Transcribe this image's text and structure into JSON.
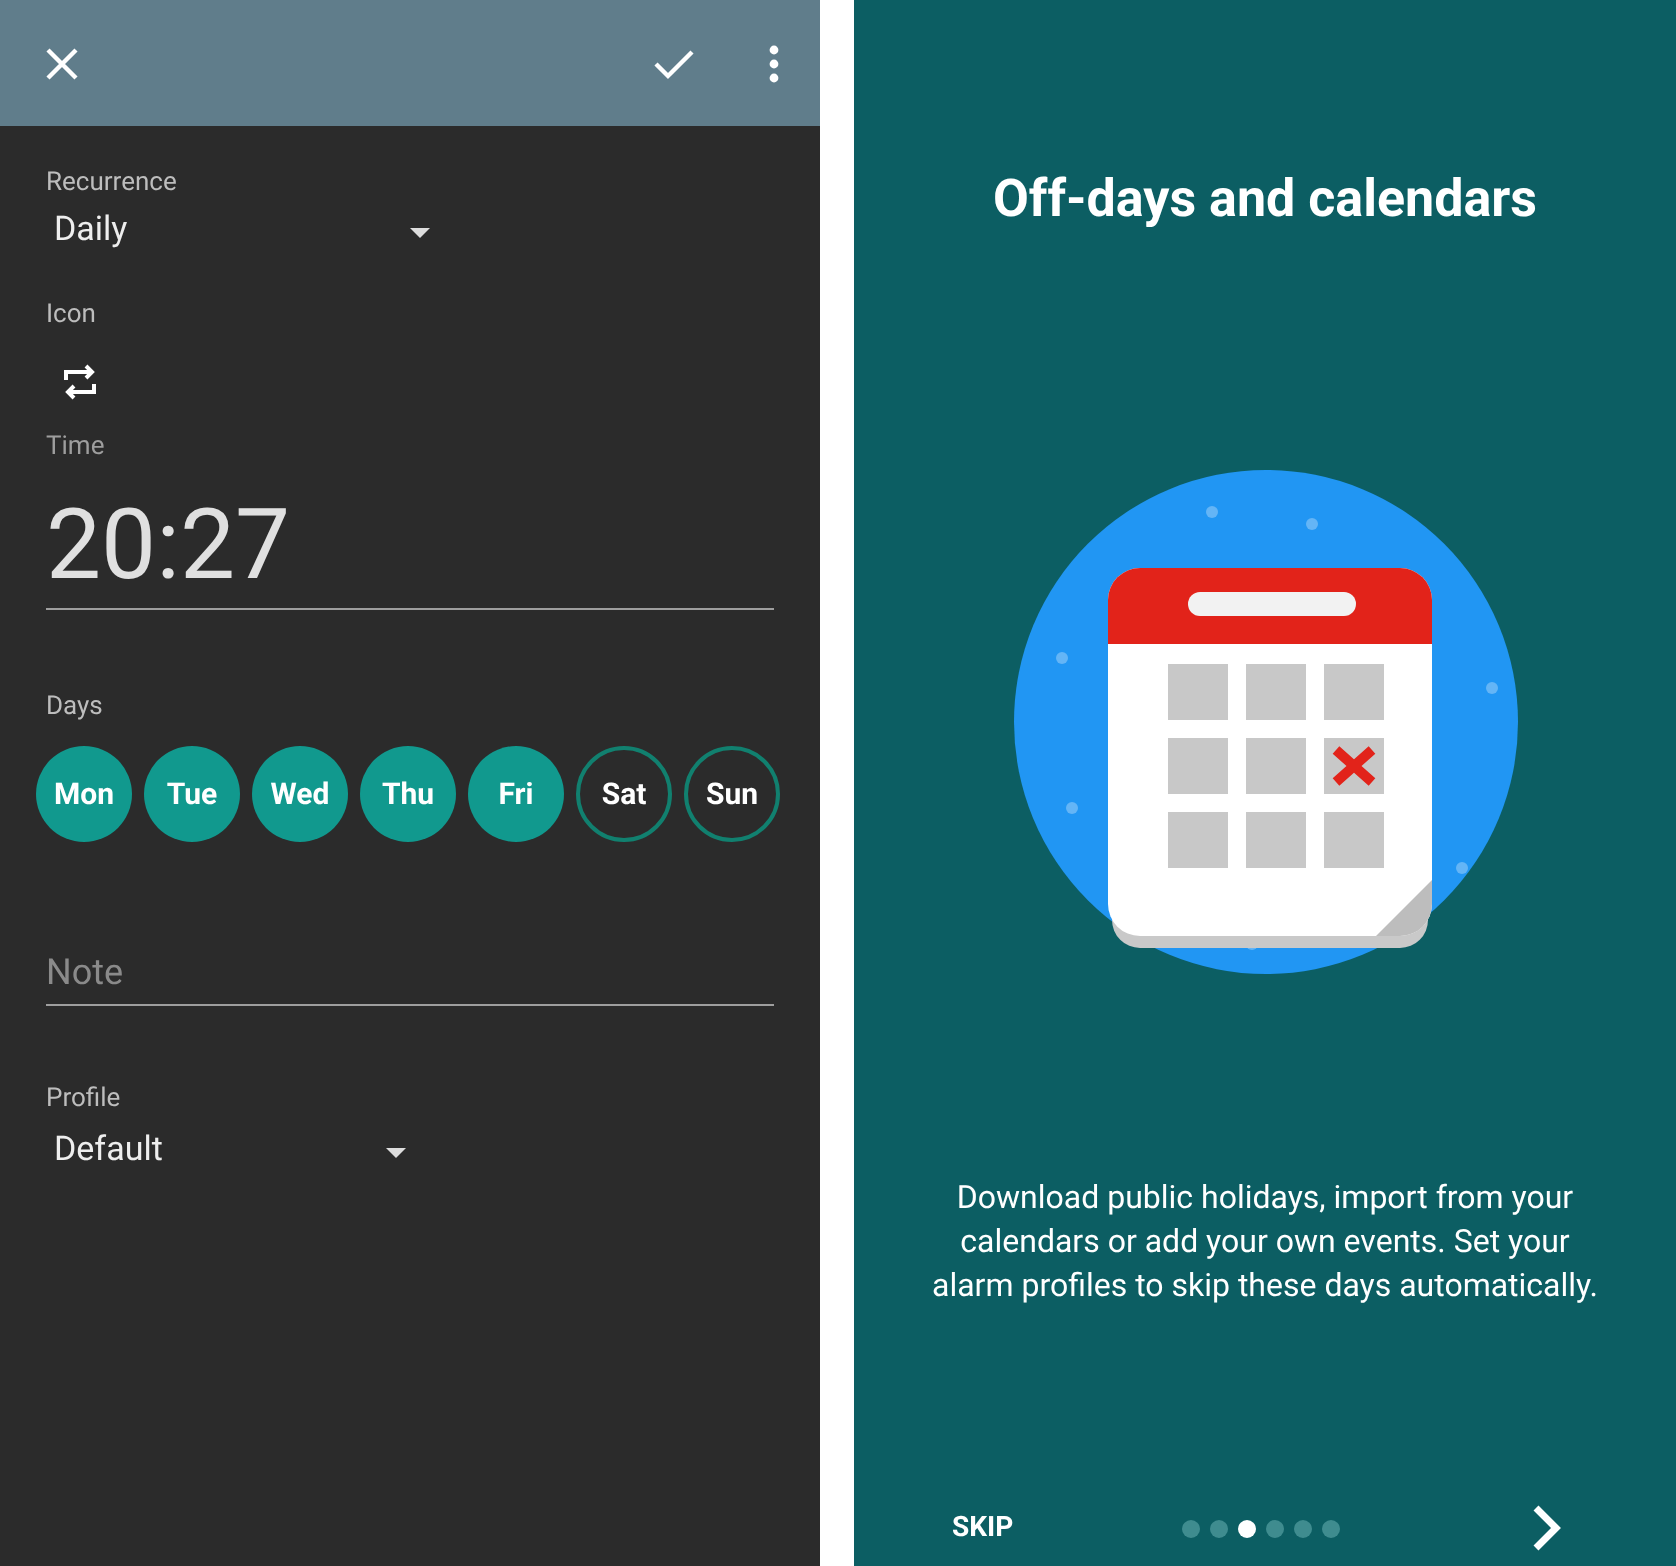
{
  "editor": {
    "recurrence": {
      "label": "Recurrence",
      "value": "Daily"
    },
    "icon": {
      "label": "Icon"
    },
    "time": {
      "label": "Time",
      "value": "20:27"
    },
    "days": {
      "label": "Days",
      "items": [
        {
          "label": "Mon",
          "selected": true
        },
        {
          "label": "Tue",
          "selected": true
        },
        {
          "label": "Wed",
          "selected": true
        },
        {
          "label": "Thu",
          "selected": true
        },
        {
          "label": "Fri",
          "selected": true
        },
        {
          "label": "Sat",
          "selected": false
        },
        {
          "label": "Sun",
          "selected": false
        }
      ]
    },
    "note": {
      "placeholder": "Note"
    },
    "profile": {
      "label": "Profile",
      "value": "Default"
    }
  },
  "onboarding": {
    "title": "Off-days and calendars",
    "description": "Download public holidays, import from your calendars or add your own events. Set your alarm profiles to skip these days automatically.",
    "skip": "SKIP",
    "pages": [
      {
        "selected": false
      },
      {
        "selected": false
      },
      {
        "selected": true
      },
      {
        "selected": false
      },
      {
        "selected": false
      },
      {
        "selected": false
      }
    ]
  }
}
